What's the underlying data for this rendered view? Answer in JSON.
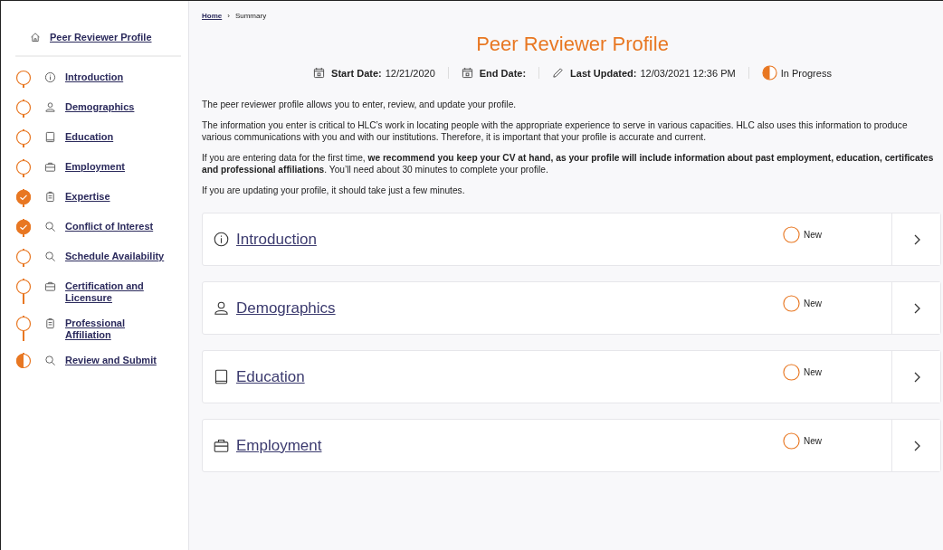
{
  "sidebar": {
    "home_link": "Peer Reviewer Profile",
    "steps": [
      {
        "label": "Introduction",
        "kind": "info",
        "done": false,
        "in_progress": false
      },
      {
        "label": "Demographics",
        "kind": "person",
        "done": false,
        "in_progress": false
      },
      {
        "label": "Education",
        "kind": "book",
        "done": false,
        "in_progress": false
      },
      {
        "label": "Employment",
        "kind": "briefcase",
        "done": false,
        "in_progress": false
      },
      {
        "label": "Expertise",
        "kind": "clipboard",
        "done": true,
        "in_progress": false
      },
      {
        "label": "Conflict of Interest",
        "kind": "search",
        "done": true,
        "in_progress": false
      },
      {
        "label": "Schedule Availability",
        "kind": "search",
        "done": false,
        "in_progress": false
      },
      {
        "label": "Certification and Licensure",
        "kind": "briefcase",
        "done": false,
        "in_progress": false
      },
      {
        "label": "Professional Affiliation",
        "kind": "clipboard",
        "done": false,
        "in_progress": false
      },
      {
        "label": "Review and Submit",
        "kind": "search",
        "done": false,
        "in_progress": true
      }
    ]
  },
  "breadcrumb": {
    "home": "Home",
    "separator": "›",
    "current": "Summary"
  },
  "title": "Peer Reviewer Profile",
  "meta": {
    "start_label": "Start Date:",
    "start_value": "12/21/2020",
    "end_label": "End Date:",
    "updated_label": "Last Updated:",
    "updated_value": "12/03/2021 12:36 PM",
    "status": "In Progress"
  },
  "paragraphs": [
    "The peer reviewer profile allows you to enter, review, and update your profile.",
    "The information you enter is critical to HLC’s work in locating people with the appropriate experience to serve in various capacities.  HLC also uses this information to produce various communications with you and with our institutions.  Therefore, it is important that your profile is accurate and current.",
    "If you are entering data for the first time, **we recommend you keep your CV at hand, as your profile will include information about past employment, education, certificates and professional affiliations**. You’ll need about 30 minutes to complete your profile.",
    "If you are updating your profile, it should take just a few minutes."
  ],
  "sections": [
    {
      "title": "Introduction",
      "kind": "info",
      "done": false,
      "in_progress": false,
      "status_label": "New"
    },
    {
      "title": "Demographics",
      "kind": "person",
      "done": false,
      "in_progress": false,
      "status_label": "New"
    },
    {
      "title": "Education",
      "kind": "book",
      "done": false,
      "in_progress": false,
      "status_label": "New"
    },
    {
      "title": "Employment",
      "kind": "briefcase",
      "done": false,
      "in_progress": false,
      "status_label": "New"
    }
  ]
}
